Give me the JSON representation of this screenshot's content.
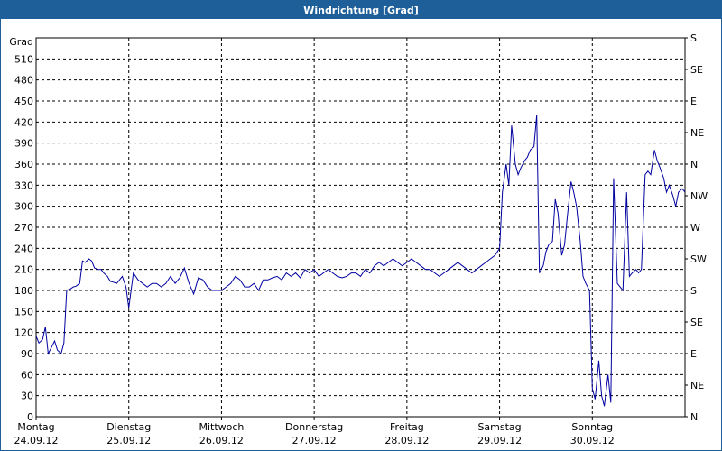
{
  "window": {
    "title": "Windrichtung [Grad]"
  },
  "colors": {
    "titlebar": "#1f5f99",
    "line": "#0000a0",
    "grid": "#000000"
  },
  "chart_data": {
    "type": "line",
    "title": "Windrichtung [Grad]",
    "ylabel": "Grad",
    "ylim": [
      0,
      540
    ],
    "yticks": [
      0,
      30,
      60,
      90,
      120,
      150,
      180,
      210,
      240,
      270,
      300,
      330,
      360,
      390,
      420,
      450,
      480,
      510
    ],
    "y2_labels": [
      "N",
      "NE",
      "E",
      "SE",
      "S",
      "SW",
      "W",
      "NW",
      "N",
      "NE",
      "E",
      "SE",
      "S"
    ],
    "xlim": [
      0,
      7
    ],
    "x_categories": [
      {
        "day": "Montag",
        "date": "24.09.12"
      },
      {
        "day": "Dienstag",
        "date": "25.09.12"
      },
      {
        "day": "Mittwoch",
        "date": "26.09.12"
      },
      {
        "day": "Donnerstag",
        "date": "27.09.12"
      },
      {
        "day": "Freitag",
        "date": "28.09.12"
      },
      {
        "day": "Samstag",
        "date": "29.09.12"
      },
      {
        "day": "Sonntag",
        "date": "30.09.12"
      }
    ],
    "grid": true,
    "series": [
      {
        "x": [
          0.0,
          0.03,
          0.07,
          0.1,
          0.13,
          0.17,
          0.2,
          0.23,
          0.27,
          0.3,
          0.33,
          0.37,
          0.4,
          0.43,
          0.47,
          0.5,
          0.53,
          0.57,
          0.6,
          0.63,
          0.67,
          0.7,
          0.73,
          0.77,
          0.8,
          0.83,
          0.87,
          0.9,
          0.93,
          0.97,
          1.0,
          1.05,
          1.1,
          1.15,
          1.2,
          1.25,
          1.3,
          1.35,
          1.4,
          1.45,
          1.5,
          1.55,
          1.6,
          1.65,
          1.7,
          1.75,
          1.8,
          1.85,
          1.9,
          1.95,
          2.0,
          2.05,
          2.1,
          2.15,
          2.2,
          2.25,
          2.3,
          2.35,
          2.4,
          2.45,
          2.5,
          2.55,
          2.6,
          2.65,
          2.7,
          2.75,
          2.8,
          2.85,
          2.9,
          2.95,
          3.0,
          3.05,
          3.1,
          3.15,
          3.2,
          3.25,
          3.3,
          3.35,
          3.4,
          3.45,
          3.5,
          3.55,
          3.6,
          3.65,
          3.7,
          3.75,
          3.8,
          3.85,
          3.9,
          3.95,
          4.0,
          4.05,
          4.1,
          4.15,
          4.2,
          4.25,
          4.3,
          4.35,
          4.4,
          4.45,
          4.5,
          4.55,
          4.6,
          4.65,
          4.7,
          4.75,
          4.8,
          4.85,
          4.9,
          4.95,
          5.0,
          5.03,
          5.07,
          5.1,
          5.13,
          5.17,
          5.2,
          5.23,
          5.27,
          5.3,
          5.33,
          5.37,
          5.4,
          5.43,
          5.47,
          5.5,
          5.53,
          5.57,
          5.6,
          5.63,
          5.67,
          5.7,
          5.73,
          5.77,
          5.8,
          5.83,
          5.87,
          5.9,
          5.93,
          5.97,
          6.0,
          6.03,
          6.07,
          6.1,
          6.13,
          6.17,
          6.2,
          6.23,
          6.27,
          6.3,
          6.33,
          6.37,
          6.4,
          6.43,
          6.47,
          6.5,
          6.53,
          6.57,
          6.6,
          6.63,
          6.67,
          6.7,
          6.73,
          6.77,
          6.8,
          6.83,
          6.87,
          6.9,
          6.93,
          6.97,
          7.0
        ],
        "values": [
          115,
          105,
          110,
          128,
          90,
          100,
          108,
          95,
          90,
          105,
          180,
          182,
          185,
          186,
          190,
          222,
          220,
          225,
          222,
          212,
          210,
          210,
          205,
          200,
          193,
          192,
          190,
          195,
          200,
          185,
          155,
          205,
          195,
          190,
          185,
          190,
          190,
          185,
          190,
          200,
          190,
          198,
          212,
          190,
          175,
          198,
          195,
          185,
          180,
          180,
          180,
          185,
          190,
          200,
          195,
          185,
          185,
          190,
          180,
          195,
          195,
          198,
          200,
          195,
          205,
          200,
          205,
          198,
          210,
          205,
          210,
          200,
          205,
          210,
          205,
          200,
          198,
          200,
          205,
          205,
          200,
          210,
          205,
          215,
          220,
          215,
          220,
          225,
          220,
          215,
          220,
          225,
          220,
          215,
          210,
          210,
          205,
          200,
          205,
          210,
          215,
          220,
          215,
          210,
          205,
          210,
          215,
          220,
          225,
          230,
          240,
          320,
          360,
          330,
          415,
          360,
          345,
          355,
          365,
          370,
          380,
          385,
          430,
          205,
          215,
          235,
          245,
          250,
          310,
          290,
          230,
          245,
          285,
          335,
          320,
          300,
          250,
          200,
          190,
          180,
          40,
          25,
          80,
          30,
          15,
          60,
          20,
          340,
          190,
          185,
          180,
          320,
          200,
          205,
          210,
          205,
          210,
          345,
          350,
          345,
          380,
          365,
          355,
          340,
          320,
          330,
          315,
          300,
          320,
          325,
          320
        ]
      }
    ]
  }
}
